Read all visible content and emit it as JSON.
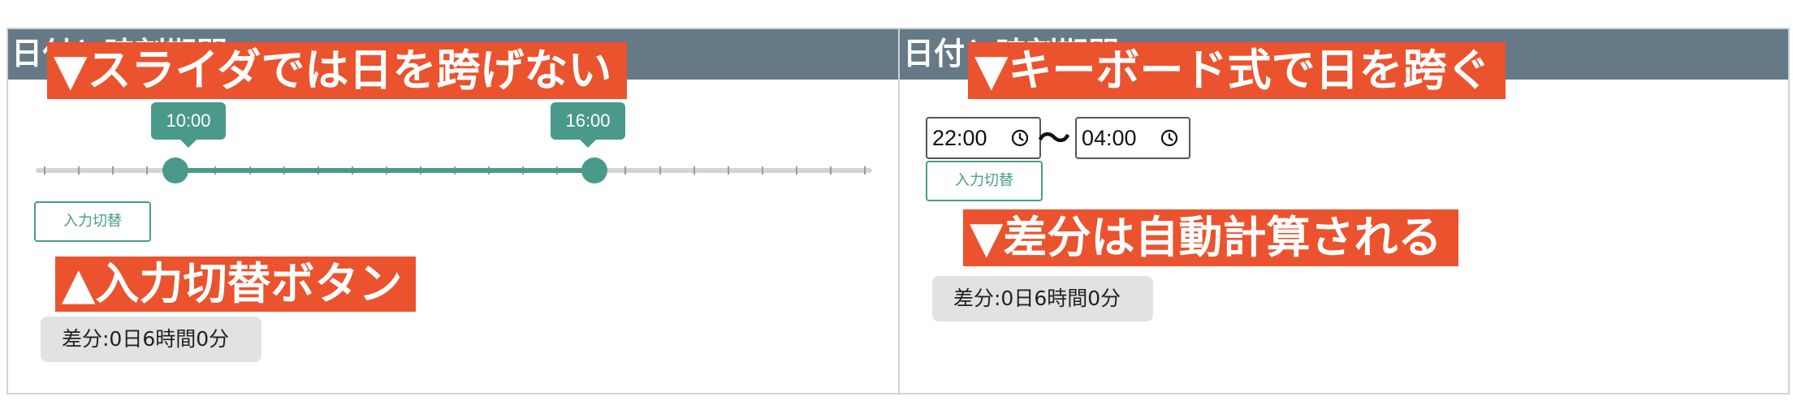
{
  "left_panel": {
    "header_title": "日付と時刻期間",
    "callout_top": "▼スライダでは日を跨げない",
    "slider": {
      "start_label": "10:00",
      "end_label": "16:00",
      "start_fraction": 0.1667,
      "end_fraction": 0.6667,
      "tick_count": 25
    },
    "toggle_button": "入力切替",
    "callout_bottom": "▲入力切替ボタン",
    "diff_text": "差分:0日6時間0分"
  },
  "right_panel": {
    "header_title": "日付と時刻期間",
    "callout_top": "▼キーボード式で日を跨ぐ",
    "start_time": "22:00",
    "separator": "〜",
    "end_time": "04:00",
    "toggle_button": "入力切替",
    "callout_middle": "▼差分は自動計算される",
    "diff_text": "差分:0日6時間0分"
  },
  "colors": {
    "header_bg": "#657a86",
    "callout_bg": "#ea532d",
    "accent": "#4a9a8c"
  },
  "icons": [
    "clock-icon"
  ]
}
